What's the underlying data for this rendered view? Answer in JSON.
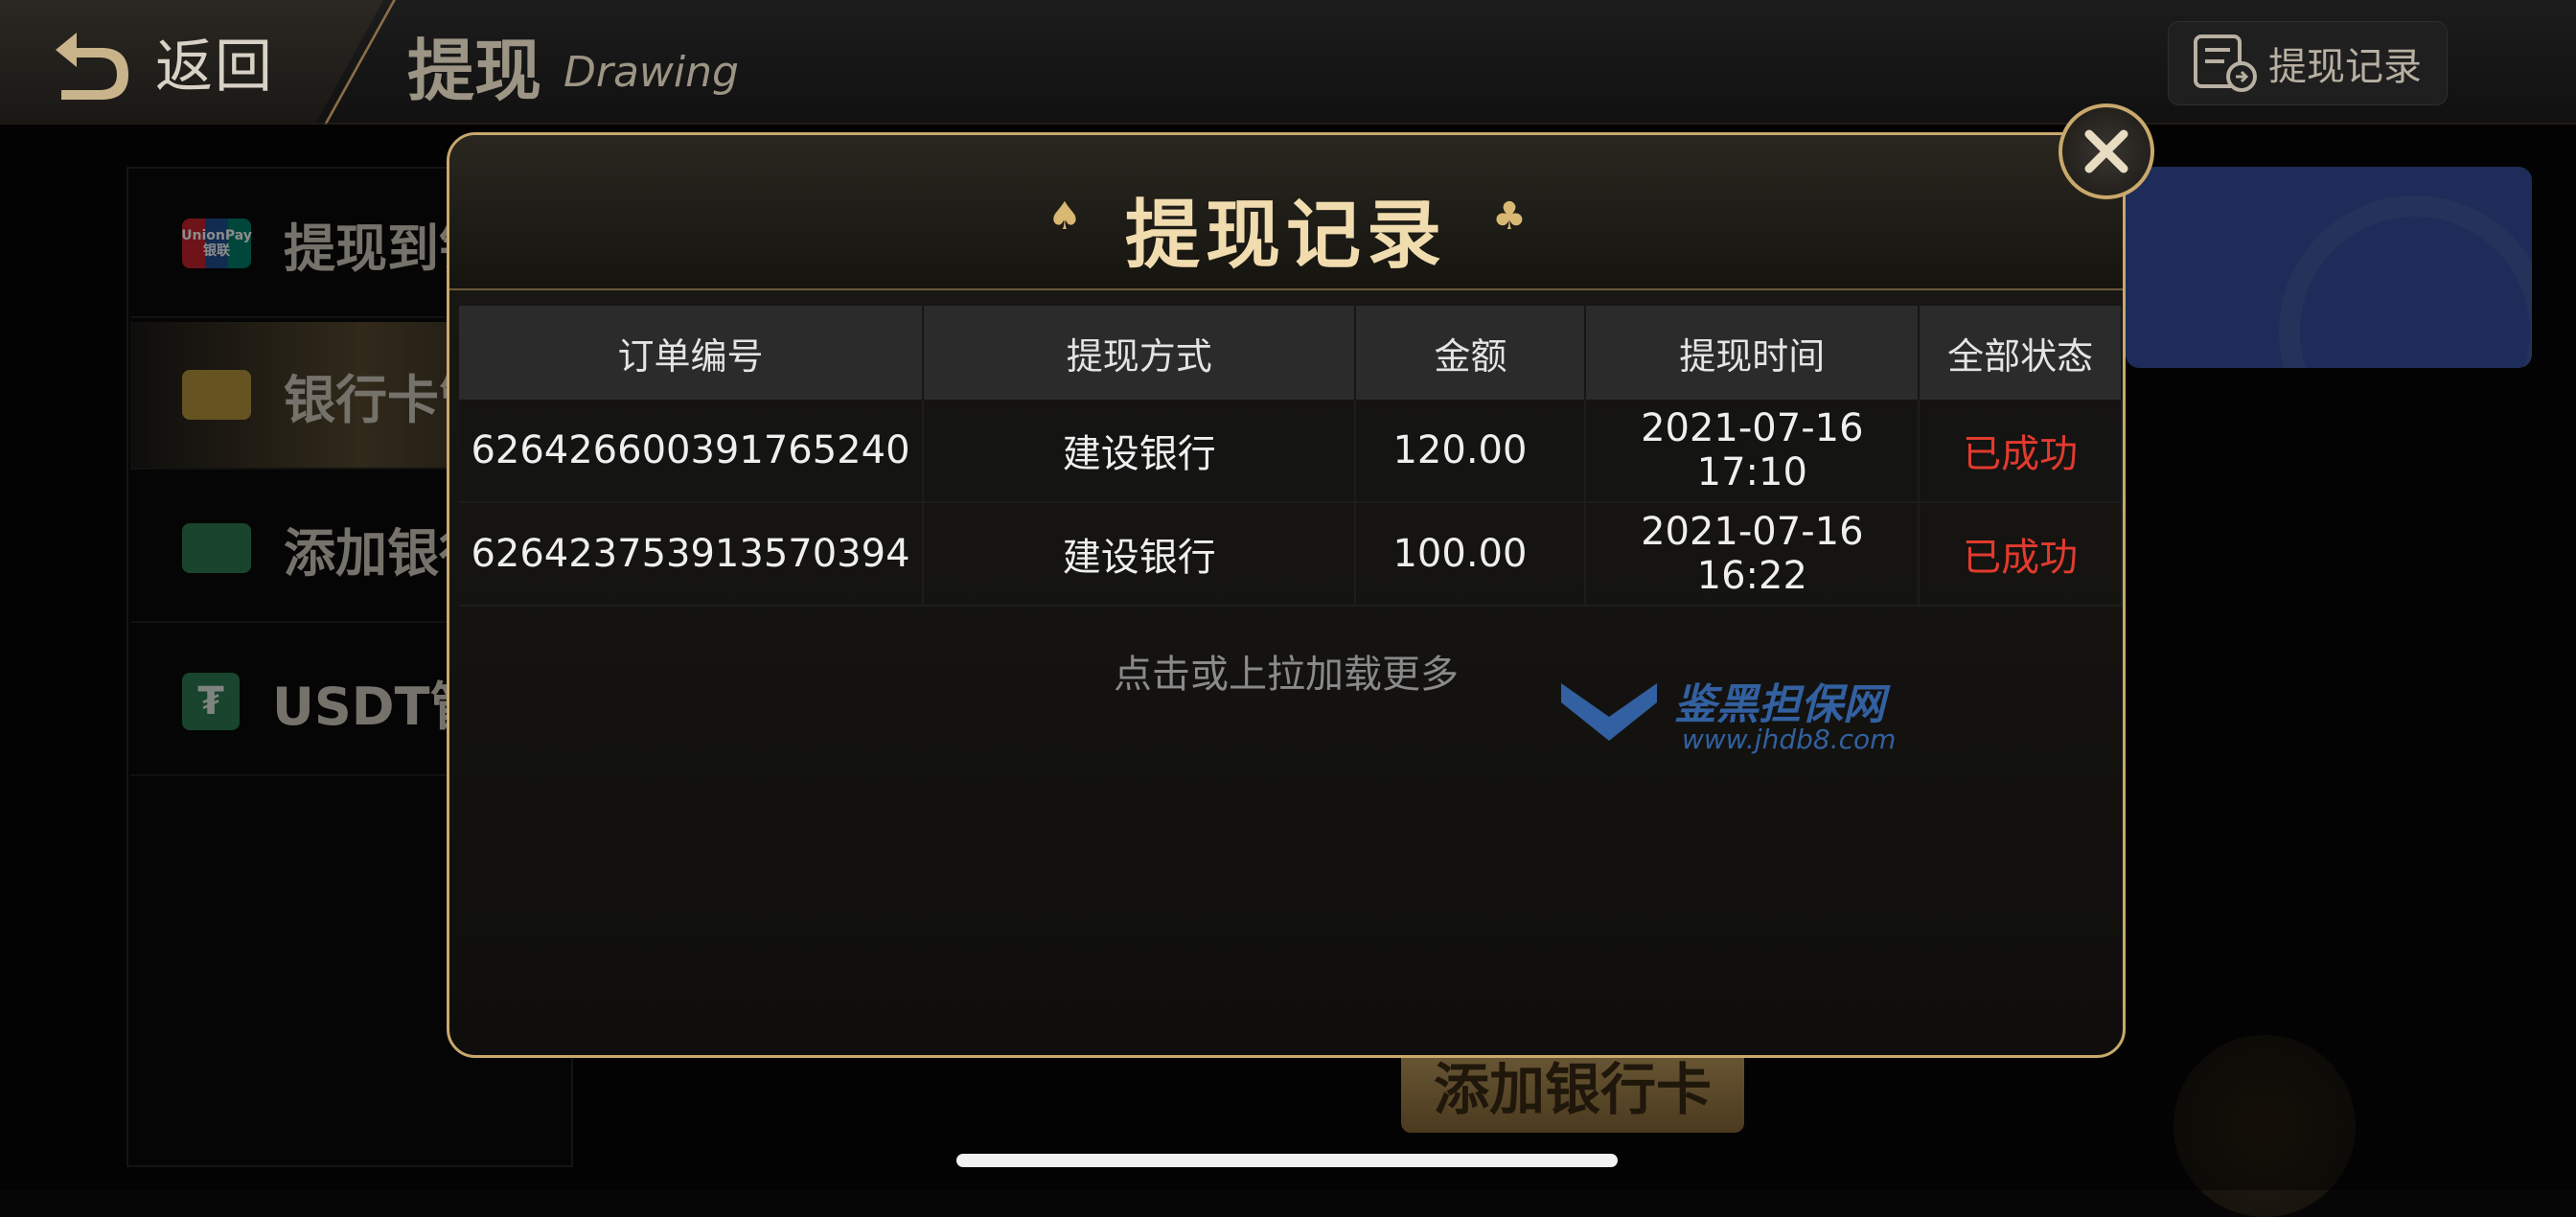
{
  "header": {
    "back_label": "返回",
    "title": "提现",
    "subtitle": "Drawing",
    "records_button_label": "提现记录"
  },
  "sidebar": {
    "items": [
      {
        "label": "提现到银",
        "icon": "unionpay-icon",
        "icon_text": "UnionPay 银联"
      },
      {
        "label": "银行卡管",
        "icon": "bank-card-icon"
      },
      {
        "label": "添加银行",
        "icon": "add-card-icon"
      },
      {
        "label": "USDT管",
        "icon": "usdt-icon",
        "icon_text": "₮"
      }
    ]
  },
  "add_card_button_label": "添加银行卡",
  "modal": {
    "title": "提现记录",
    "suit_left": "♠",
    "suit_right": "♣",
    "columns": [
      "订单编号",
      "提现方式",
      "金额",
      "提现时间",
      "全部状态"
    ],
    "rows": [
      {
        "order_no": "626426600391765240",
        "method": "建设银行",
        "amount": "120.00",
        "time": "2021-07-16 17:10",
        "status": "已成功"
      },
      {
        "order_no": "626423753913570394",
        "method": "建设银行",
        "amount": "100.00",
        "time": "2021-07-16 16:22",
        "status": "已成功"
      }
    ],
    "load_more": "点击或上拉加载更多",
    "watermark_text": "鉴黑担保网",
    "watermark_url": "www.jhdb8.com"
  },
  "colors": {
    "accent_gold": "#c9a86c",
    "status_success": "#e23a2e",
    "card_blue": "#3550a0"
  }
}
